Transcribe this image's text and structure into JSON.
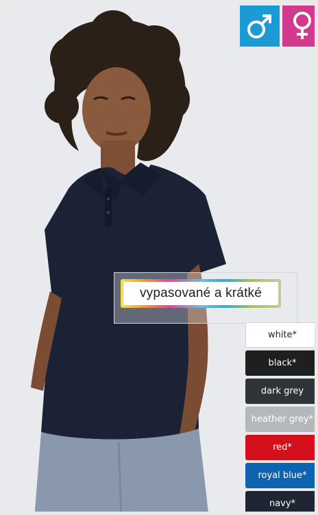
{
  "gender": {
    "male_icon": "male-symbol-icon",
    "female_icon": "female-symbol-icon",
    "male_color": "#1b9ad3",
    "female_color": "#d23a8e"
  },
  "fit": {
    "label": "vypasované a krátké"
  },
  "colors": [
    {
      "label": "white*",
      "hex": "#ffffff"
    },
    {
      "label": "black*",
      "hex": "#1f1f1f"
    },
    {
      "label": "dark grey",
      "hex": "#2f3439"
    },
    {
      "label": "heather grey*",
      "hex": "#b5b7ba"
    },
    {
      "label": "red*",
      "hex": "#d3101c"
    },
    {
      "label": "royal blue*",
      "hex": "#0d63ad"
    },
    {
      "label": "navy*",
      "hex": "#1f2533"
    }
  ]
}
